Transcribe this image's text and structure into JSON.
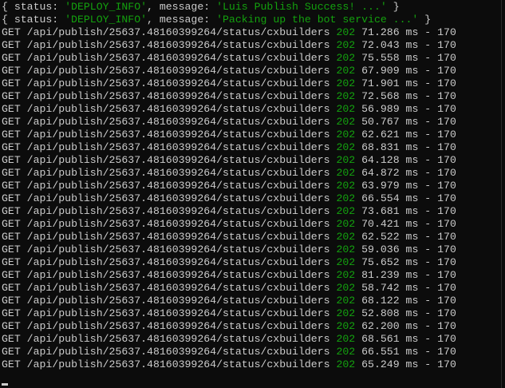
{
  "info_lines": [
    {
      "open": "{ status: ",
      "status": "'DEPLOY_INFO'",
      "mid": ", message: ",
      "message": "'Luis Publish Success! ...'",
      "close": " }"
    },
    {
      "open": "{ status: ",
      "status": "'DEPLOY_INFO'",
      "mid": ", message: ",
      "message": "'Packing up the bot service ...'",
      "close": " }"
    }
  ],
  "request": {
    "method": "GET",
    "path": "/api/publish/25637.48160399264/status/cxbuilders",
    "status_code": "202",
    "unit": "ms",
    "separator": "-",
    "size": "170"
  },
  "times_ms": [
    "71.286",
    "72.043",
    "75.558",
    "67.909",
    "71.901",
    "72.568",
    "56.989",
    "50.767",
    "62.621",
    "68.831",
    "64.128",
    "64.872",
    "63.979",
    "66.554",
    "73.681",
    "70.421",
    "62.522",
    "59.036",
    "75.652",
    "81.239",
    "58.742",
    "68.122",
    "52.808",
    "62.200",
    "68.561",
    "66.551",
    "65.249"
  ],
  "colors": {
    "background": "#0c0c0c",
    "text": "#cccccc",
    "string": "#13a10e",
    "status_code": "#13a10e"
  }
}
